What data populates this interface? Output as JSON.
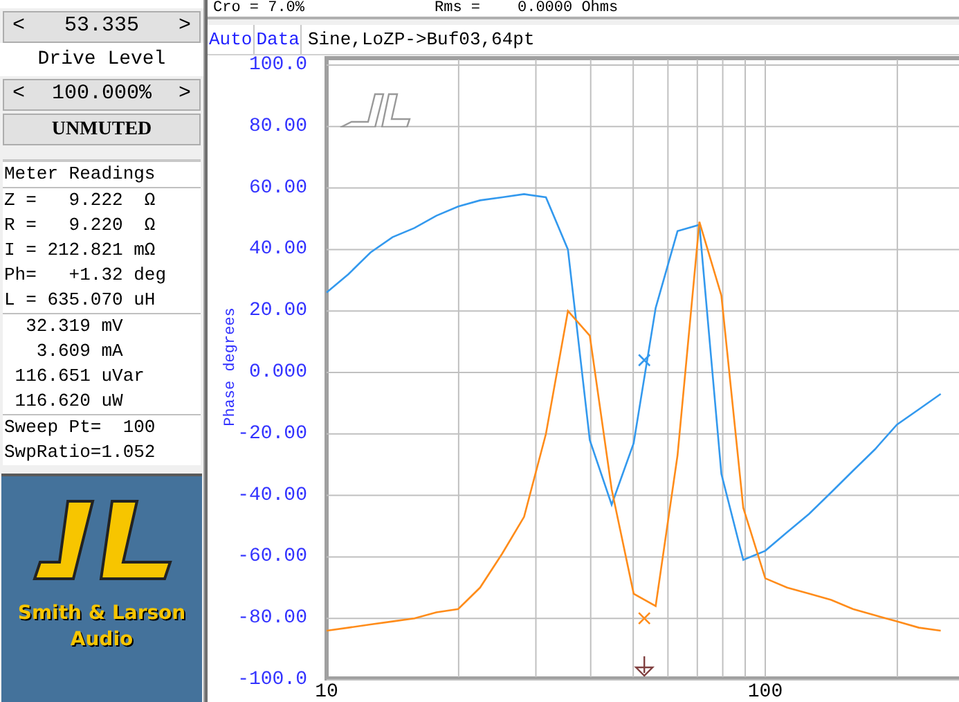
{
  "status": [
    "Cro = 7.0%",
    "Rms =",
    "0.0000 Ohms"
  ],
  "controls": {
    "stepper": {
      "left": "<",
      "value": "53.335",
      "right": ">"
    },
    "drive_level": {
      "label": "Drive Level",
      "left": "<",
      "value": "100.000%",
      "right": ">"
    },
    "mute_button": "UNMUTED"
  },
  "meter": {
    "title": "Meter Readings",
    "impedance": [
      "Z =   9.222  Ω",
      "R =   9.220  Ω",
      "I = 212.821 mΩ",
      "Ph=   +1.32 deg",
      "L = 635.070 uH"
    ],
    "power": [
      "  32.319 mV",
      "   3.609 mA",
      " 116.651 uVar",
      " 116.620 uW"
    ],
    "sweep": [
      "Sweep Pt=  100",
      "SwpRatio=1.052"
    ]
  },
  "logo": {
    "line_1": "Smith & Larson",
    "line_2": "Audio"
  },
  "graph": {
    "buttons": [
      "Auto",
      "Data"
    ],
    "title": "Sine,LoZP->Buf03,64pt",
    "chart_data": {
      "type": "line",
      "ylabel": "Phase degrees",
      "categories": [
        "10",
        null,
        null,
        null,
        null,
        null,
        null,
        null,
        null,
        null,
        null,
        null,
        null,
        null,
        null,
        null,
        null,
        null,
        null,
        null,
        "100",
        null,
        null,
        null,
        null,
        null,
        null,
        null,
        null
      ],
      "series": [
        {
          "color": "#3399ee",
          "values": [
            26,
            32,
            39,
            44,
            47,
            51,
            54,
            56,
            57,
            58,
            57,
            40,
            -22,
            -43,
            -23,
            21,
            46,
            48,
            -33,
            -61,
            -58,
            -52,
            -46,
            -39,
            -32,
            -25,
            -17,
            -12,
            -7
          ]
        },
        {
          "color": "#ff8c1a",
          "values": [
            -84,
            -83,
            -82,
            -81,
            -80,
            -78,
            -77,
            -70,
            -59,
            -47,
            -20,
            20,
            12,
            -38,
            -72,
            -76,
            -27,
            49,
            25,
            -44,
            -67,
            -70,
            -72,
            -74,
            -77,
            -79,
            -81,
            -83,
            -84
          ]
        }
      ],
      "ylim": [
        -100,
        100
      ],
      "grid": true,
      "yticks": [
        {
          "value": 100,
          "label": "100.0"
        },
        {
          "value": 80,
          "label": "80.00"
        },
        {
          "value": 60,
          "label": "60.00"
        },
        {
          "value": 40,
          "label": "40.00"
        },
        {
          "value": 20,
          "label": "20.00"
        },
        {
          "value": 0,
          "label": "0.000"
        },
        {
          "value": -20,
          "label": "-20.00"
        },
        {
          "value": -40,
          "label": "-40.00"
        },
        {
          "value": -60,
          "label": "-60.00"
        },
        {
          "value": -80,
          "label": "-80.00"
        },
        {
          "value": -100,
          "label": "-100.0"
        }
      ]
    }
  }
}
